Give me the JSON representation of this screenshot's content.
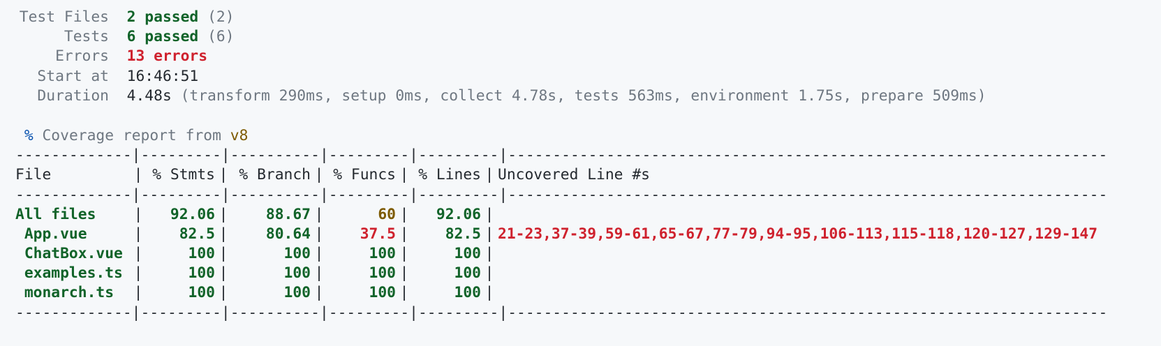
{
  "summary": {
    "test_files": {
      "label": "Test Files",
      "value": "2 passed",
      "suffix": "(2)"
    },
    "tests": {
      "label": "Tests",
      "value": "6 passed",
      "suffix": "(6)"
    },
    "errors": {
      "label": "Errors",
      "value": "13 errors"
    },
    "start_at": {
      "label": "Start at",
      "value": "16:46:51"
    },
    "duration": {
      "label": "Duration",
      "value": "4.48s",
      "detail": "(transform 290ms, setup 0ms, collect 4.78s, tests 563ms, environment 1.75s, prepare 509ms)"
    }
  },
  "coverage_header": {
    "icon": "%",
    "text": "Coverage report from",
    "provider": "v8"
  },
  "table": {
    "separator": "-------------|---------|----------|---------|---------|-------------------------------------------------------------------",
    "columns": [
      "File",
      "% Stmts",
      "% Branch",
      "% Funcs",
      "% Lines",
      "Uncovered Line #s"
    ],
    "rows": [
      {
        "file": "All files",
        "stmts": "92.06",
        "branch": "88.67",
        "funcs": "60",
        "lines": "92.06",
        "uncovered": ""
      },
      {
        "file": " App.vue",
        "stmts": "82.5",
        "branch": "80.64",
        "funcs": "37.5",
        "lines": "82.5",
        "uncovered": "21-23,37-39,59-61,65-67,77-79,94-95,106-113,115-118,120-127,129-147"
      },
      {
        "file": " ChatBox.vue",
        "stmts": "100",
        "branch": "100",
        "funcs": "100",
        "lines": "100",
        "uncovered": ""
      },
      {
        "file": " examples.ts",
        "stmts": "100",
        "branch": "100",
        "funcs": "100",
        "lines": "100",
        "uncovered": ""
      },
      {
        "file": " monarch.ts",
        "stmts": "100",
        "branch": "100",
        "funcs": "100",
        "lines": "100",
        "uncovered": ""
      }
    ]
  },
  "colors": {
    "pass": "#116329",
    "error": "#cf222e",
    "warn": "#7d5a00",
    "accent": "#0550ae",
    "muted": "#6e7781",
    "background": "#f6f8fa"
  }
}
